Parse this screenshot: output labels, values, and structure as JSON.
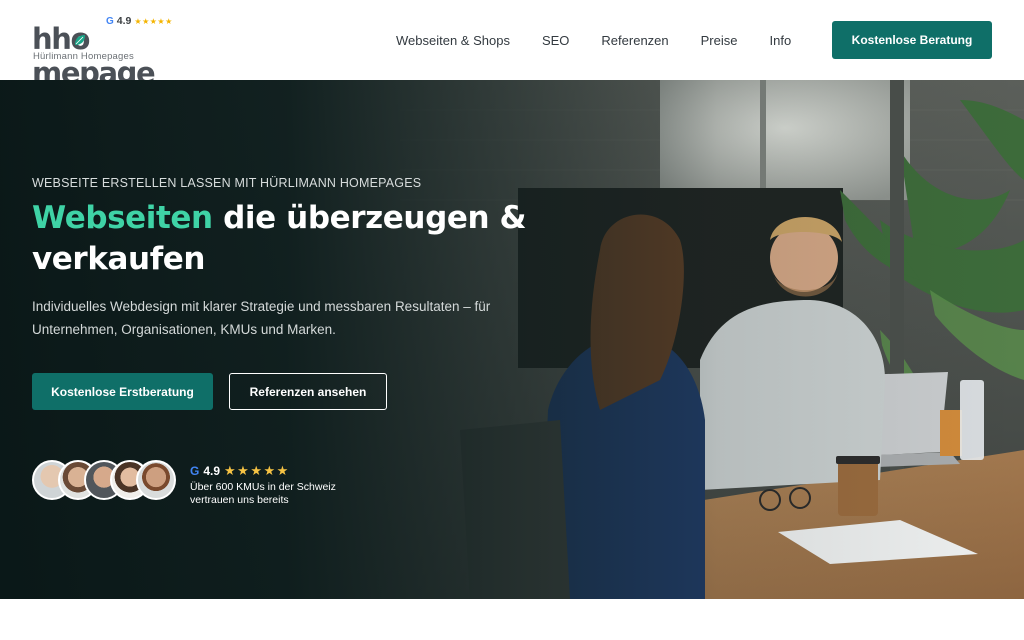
{
  "header": {
    "logo": {
      "wordmark": "hhomepage",
      "wordmark_prefix": "hh",
      "wordmark_o": "o",
      "wordmark_suffix": "mepage",
      "subtitle": "Hürlimann Homepages",
      "google_glyph": "G",
      "rating": "4.9",
      "stars": "★★★★★"
    },
    "nav": [
      {
        "label": "Webseiten & Shops"
      },
      {
        "label": "SEO"
      },
      {
        "label": "Referenzen"
      },
      {
        "label": "Preise"
      },
      {
        "label": "Info"
      }
    ],
    "cta_label": "Kostenlose Beratung"
  },
  "hero": {
    "eyebrow": "WEBSEITE ERSTELLEN LASSEN MIT HÜRLIMANN HOMEPAGES",
    "headline_accent": "Webseiten",
    "headline_rest": " die überzeugen & verkaufen",
    "lead": "Individuelles Webdesign mit klarer Strategie und messbaren Resultaten – für Unternehmen, Organisationen, KMUs und Marken.",
    "primary_button": "Kostenlose Erstberatung",
    "secondary_button": "Referenzen ansehen",
    "social_proof": {
      "google_glyph": "G",
      "rating": "4.9",
      "stars": "★★★★★",
      "text": "Über 600 KMUs in der Schweiz vertrauen uns bereits",
      "avatar_count": 5
    }
  },
  "colors": {
    "brand_teal": "#0f6f68",
    "accent_green": "#3fd3a6",
    "star_yellow": "#f6c344",
    "text_dark": "#333a40"
  }
}
